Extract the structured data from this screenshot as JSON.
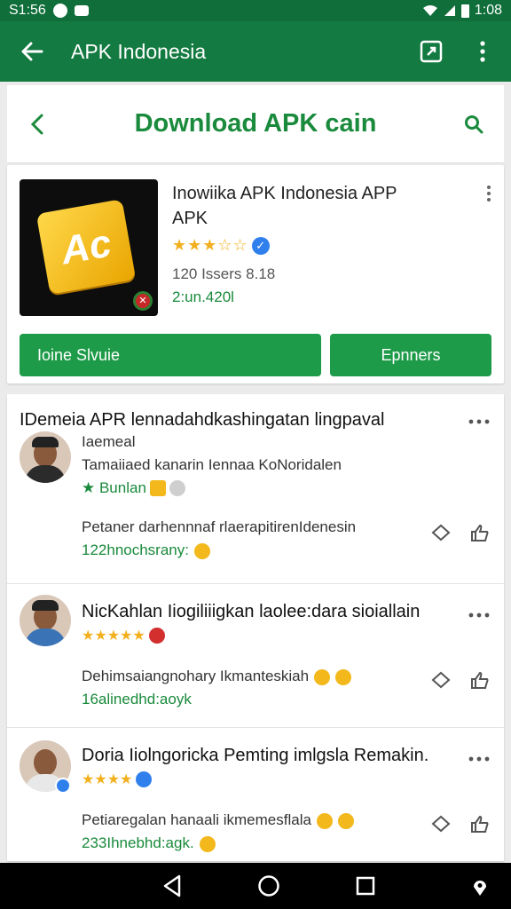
{
  "status_bar": {
    "time_left": "S1:56",
    "time_right": "1:08"
  },
  "app_bar": {
    "title": "APK Indonesia"
  },
  "search": {
    "title": "Download APK cain"
  },
  "app": {
    "name_line1": "Inowiika APK Indonesia APP",
    "name_line2": "APK",
    "stars": "★★★☆☆",
    "meta_line": "120 Issers 8.18",
    "meta_green": "2:un.420l",
    "install_label": "Ioine Slvuie",
    "open_label": "Epnners"
  },
  "reviews": [
    {
      "title": "IDemeia APR lennadahdkashingatan lingpaval",
      "name": "Iaemeal",
      "subtitle": "Tamaiiaed kanarin Iennaa KoNoridalen",
      "stars_label": "★ Bunlan",
      "body": "Petaner darhennnaf rlaerapitirenIdenesin",
      "footer": "122hnochsrany:"
    },
    {
      "title": "NicKahlan Iiogiliiigkan laolee:dara sioiallain",
      "stars": "★★★★★",
      "body": "Dehimsaiangnohary Ikmanteskiah",
      "footer": "16alinedhd:aoyk"
    },
    {
      "title": "Doria Iiolngoricka Pemting imlgsla Remakin.",
      "stars": "★★★★",
      "body": "Petiaregalan hanaali ikmemesflala",
      "footer": "233Ihnebhd:agk."
    }
  ],
  "colors": {
    "primary_dark": "#0f6e3a",
    "primary": "#137a41",
    "accent_green": "#1e9b49",
    "star": "#f2b01e"
  }
}
